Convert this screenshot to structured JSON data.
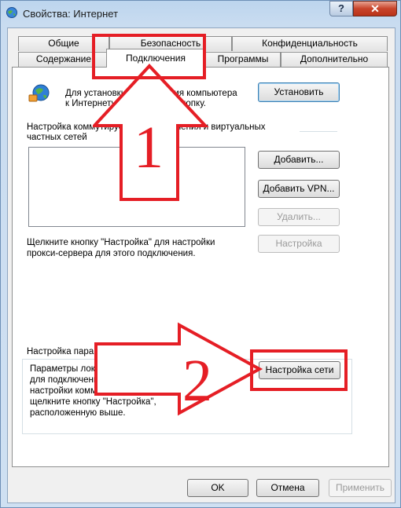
{
  "window": {
    "title": "Свойства: Интернет",
    "help_label": "?",
    "close_label": "✕",
    "app_icon": "internet-options-icon"
  },
  "tabs": {
    "row1": [
      "Общие",
      "Безопасность",
      "Конфиденциальность"
    ],
    "row2": [
      "Содержание",
      "Подключения",
      "Программы",
      "Дополнительно"
    ],
    "active": "Подключения"
  },
  "setup": {
    "text_line1": "Для установки подключения компьютера",
    "text_line2": "к Интернету щелкните эту кнопку.",
    "button": "Установить"
  },
  "dialup": {
    "header_line1": "Настройка коммутируемого подключения и виртуальных",
    "header_line2": "частных сетей",
    "add_button": "Добавить...",
    "add_vpn_button": "Добавить VPN...",
    "delete_button": "Удалить...",
    "settings_text_line1": "Щелкните кнопку \"Настройка\" для настройки",
    "settings_text_line2": "прокси-сервера для этого подключения.",
    "settings_button": "Настройка"
  },
  "lan": {
    "header": "Настройка параметров локальной сети",
    "text_line1": "Параметры локальной сети не применяются",
    "text_line2": "для подключений удаленного доступа. Для",
    "text_line3": "настройки коммутируемого соединения",
    "text_line4": "щелкните кнопку \"Настройка\",",
    "text_line5": "расположенную выше.",
    "button": "Настройка сети"
  },
  "footer": {
    "ok": "OK",
    "cancel": "Отмена",
    "apply": "Применить"
  },
  "annotations": {
    "step1": "1",
    "step2": "2",
    "color": "#e51e25"
  }
}
